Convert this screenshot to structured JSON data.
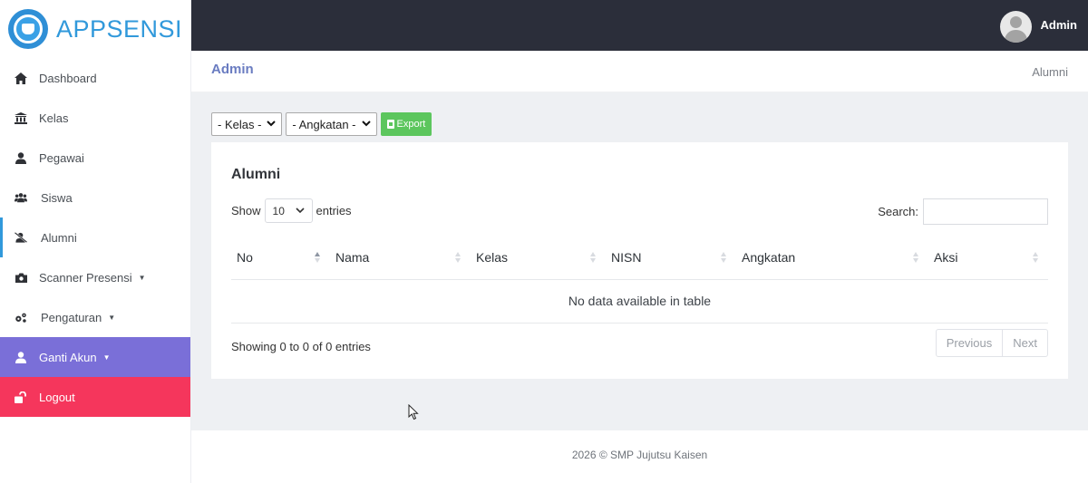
{
  "brand": {
    "name": "APPSENSI"
  },
  "topbar": {
    "user_name": "Admin"
  },
  "sidebar": {
    "items": [
      {
        "label": "Dashboard",
        "icon": "home-icon"
      },
      {
        "label": "Kelas",
        "icon": "institution-icon"
      },
      {
        "label": "Pegawai",
        "icon": "user-tie-icon"
      },
      {
        "label": "Siswa",
        "icon": "users-icon"
      },
      {
        "label": "Alumni",
        "icon": "user-slash-icon",
        "active": true
      },
      {
        "label": "Scanner Presensi",
        "icon": "camera-icon",
        "dropdown": true
      },
      {
        "label": "Pengaturan",
        "icon": "cogs-icon",
        "dropdown": true
      },
      {
        "label": "Ganti Akun",
        "icon": "user-icon",
        "dropdown": true
      },
      {
        "label": "Logout",
        "icon": "unlock-icon"
      }
    ]
  },
  "page_header": {
    "title": "Admin",
    "breadcrumb": "Alumni"
  },
  "filters": {
    "kelas": "- Kelas -",
    "angkatan": "- Angkatan -",
    "export_label": "Export"
  },
  "card": {
    "title": "Alumni",
    "length": {
      "show": "Show",
      "value": "10",
      "entries": "entries"
    },
    "search_label": "Search:",
    "columns": [
      "No",
      "Nama",
      "Kelas",
      "NISN",
      "Angkatan",
      "Aksi"
    ],
    "empty_message": "No data available in table",
    "info": "Showing 0 to 0 of 0 entries",
    "pager": {
      "previous": "Previous",
      "next": "Next"
    }
  },
  "footer": {
    "text": "2026 © SMP Jujutsu Kaisen"
  },
  "colors": {
    "topbar": "#2b2e3a",
    "brand": "#3199db",
    "ganti_akun": "#7a6fd8",
    "logout": "#f5365c",
    "export": "#5cc65d",
    "page_title": "#6a7cc1"
  }
}
